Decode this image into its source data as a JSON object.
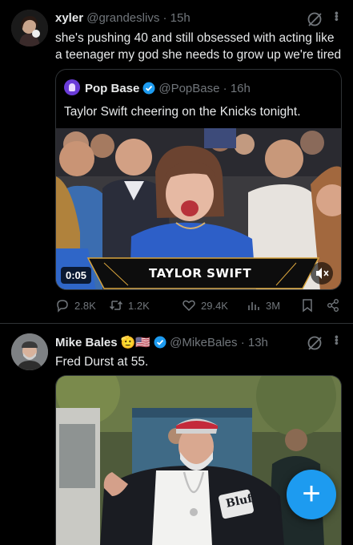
{
  "tweets": [
    {
      "name": "xyler",
      "handle": "@grandeslivs",
      "sep": "·",
      "time": "15h",
      "text_line1": "she's pushing 40 and still obsessed with acting like",
      "text_line2": "a teenager my god she needs to grow up we're tired",
      "quote": {
        "name": "Pop Base",
        "handle": "@PopBase",
        "sep": "·",
        "time": "16h",
        "text": "Taylor Swift cheering on the Knicks tonight.",
        "video_time": "0:05",
        "banner": "TAYLOR SWIFT"
      },
      "stats": {
        "replies": "2.8K",
        "reposts": "1.2K",
        "likes": "29.4K",
        "views": "3M"
      }
    },
    {
      "name": "Mike Bales",
      "emoji": "🫡",
      "flag": "🇺🇸",
      "handle": "@MikeBales",
      "sep": "·",
      "time": "13h",
      "text": "Fred Durst at 55.",
      "jersey_text": "Bluff"
    }
  ],
  "fab_label": "+",
  "colors": {
    "accent": "#1d9bf0",
    "muted": "#71767b",
    "border": "#2f3336",
    "text": "#e7e9ea"
  }
}
